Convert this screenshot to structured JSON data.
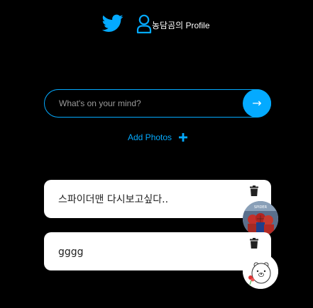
{
  "nav": {
    "home_icon": "twitter-icon",
    "profile_icon": "user-icon",
    "profile_label": "농담곰의 Profile"
  },
  "composer": {
    "placeholder": "What's on your mind?",
    "value": "",
    "submit_label": "→"
  },
  "add_photos": {
    "label": "Add Photos",
    "icon": "plus-icon"
  },
  "tweets": [
    {
      "text": "스파이더맨 다시보고싶다..",
      "delete_icon": "trash-icon",
      "image": "spiderman-photo"
    },
    {
      "text": "gggg",
      "delete_icon": "trash-icon",
      "image": "bear-sticker"
    }
  ],
  "colors": {
    "accent": "#04aaff",
    "background": "#000000",
    "card": "#ffffff"
  }
}
